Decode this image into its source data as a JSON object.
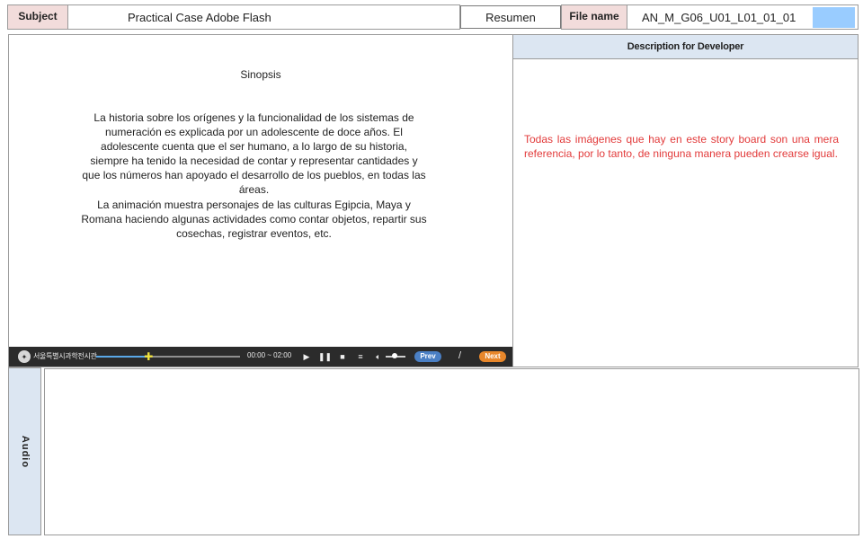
{
  "header": {
    "subject_label": "Subject",
    "subject_value": "Practical Case Adobe Flash",
    "tab_label": "Resumen",
    "filename_label": "File name",
    "filename_value": "AN_M_G06_U01_L01_01_01",
    "swatch_color": "#99ccff"
  },
  "screen": {
    "synopsis_title": "Sinopsis",
    "synopsis_paragraphs": [
      "La historia sobre los orígenes y la funcionalidad de los sistemas de numeración es explicada por un adolescente de doce años. El adolescente cuenta que el ser humano, a lo largo de su historia, siempre ha tenido la necesidad de contar y representar cantidades y que los números han apoyado el desarrollo de los pueblos, en todas las áreas.",
      "La animación muestra personajes de las culturas Egipcia, Maya y Romana haciendo algunas actividades como contar objetos, repartir sus cosechas, registrar eventos, etc."
    ]
  },
  "player": {
    "org_name": "서울특별시과학전시관",
    "logo_icon": "seal-icon",
    "progress_fraction": 0.37,
    "time": "00:00 ~ 02:00",
    "controls": [
      "play-icon",
      "pause-icon",
      "stop-icon",
      "list-icon",
      "volume-icon"
    ],
    "prev_label": "Prev",
    "page_separator": "/",
    "next_label": "Next",
    "prev_color": "#4a7fc4",
    "next_color": "#e8872b"
  },
  "developer": {
    "header": "Description for Developer",
    "note": "Todas las imágenes que hay en este story board son una mera referencia, por lo tanto, de ninguna manera pueden crearse igual.",
    "note_color": "#e23a3a"
  },
  "audio": {
    "label": "Audio"
  }
}
